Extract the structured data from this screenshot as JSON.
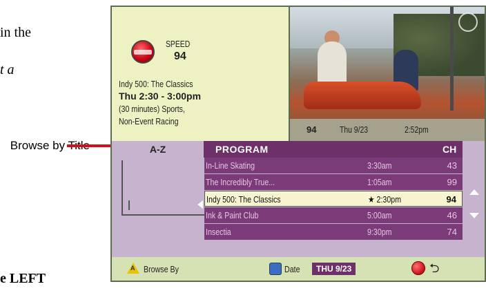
{
  "document": {
    "fragment_1": "in the",
    "fragment_2": "t a",
    "fragment_3": "e LEFT",
    "callout": "Browse by Title"
  },
  "info_panel": {
    "channel_name": "SPEED",
    "channel_number": "94",
    "program_title": "Indy 500: The Classics",
    "program_time": "Thu 2:30 - 3:00pm",
    "duration_category": "(30 minutes) Sports,",
    "genre": "Non-Event Racing"
  },
  "video_status": {
    "channel": "94",
    "date": "Thu 9/23",
    "clock": "2:52pm"
  },
  "grid": {
    "az_tab": "A-Z",
    "col_program": "PROGRAM",
    "col_channel": "CH",
    "rows": [
      {
        "title": "In-Line Skating",
        "time": "3:30am",
        "ch": "43"
      },
      {
        "title": "The Incredibly True...",
        "time": "1:05am",
        "ch": "99"
      },
      {
        "title": "Indy 500: The Classics",
        "time": "★ 2:30pm",
        "ch": "94"
      },
      {
        "title": "Ink & Paint Club",
        "time": "5:00am",
        "ch": "46"
      },
      {
        "title": "Insectia",
        "time": "9:30pm",
        "ch": "74"
      }
    ],
    "selected_index": 2
  },
  "footer": {
    "a_glyph": "A",
    "browse_by": "Browse By",
    "date_label": "Date",
    "date_value": "THU 9/23",
    "return_glyph": "⮌"
  },
  "colors": {
    "accent_purple": "#6e3068",
    "row_purple": "#7b3a78",
    "panel_green": "#d6e2b4",
    "info_cream": "#eef2c2",
    "callout_red": "#d0101a"
  }
}
